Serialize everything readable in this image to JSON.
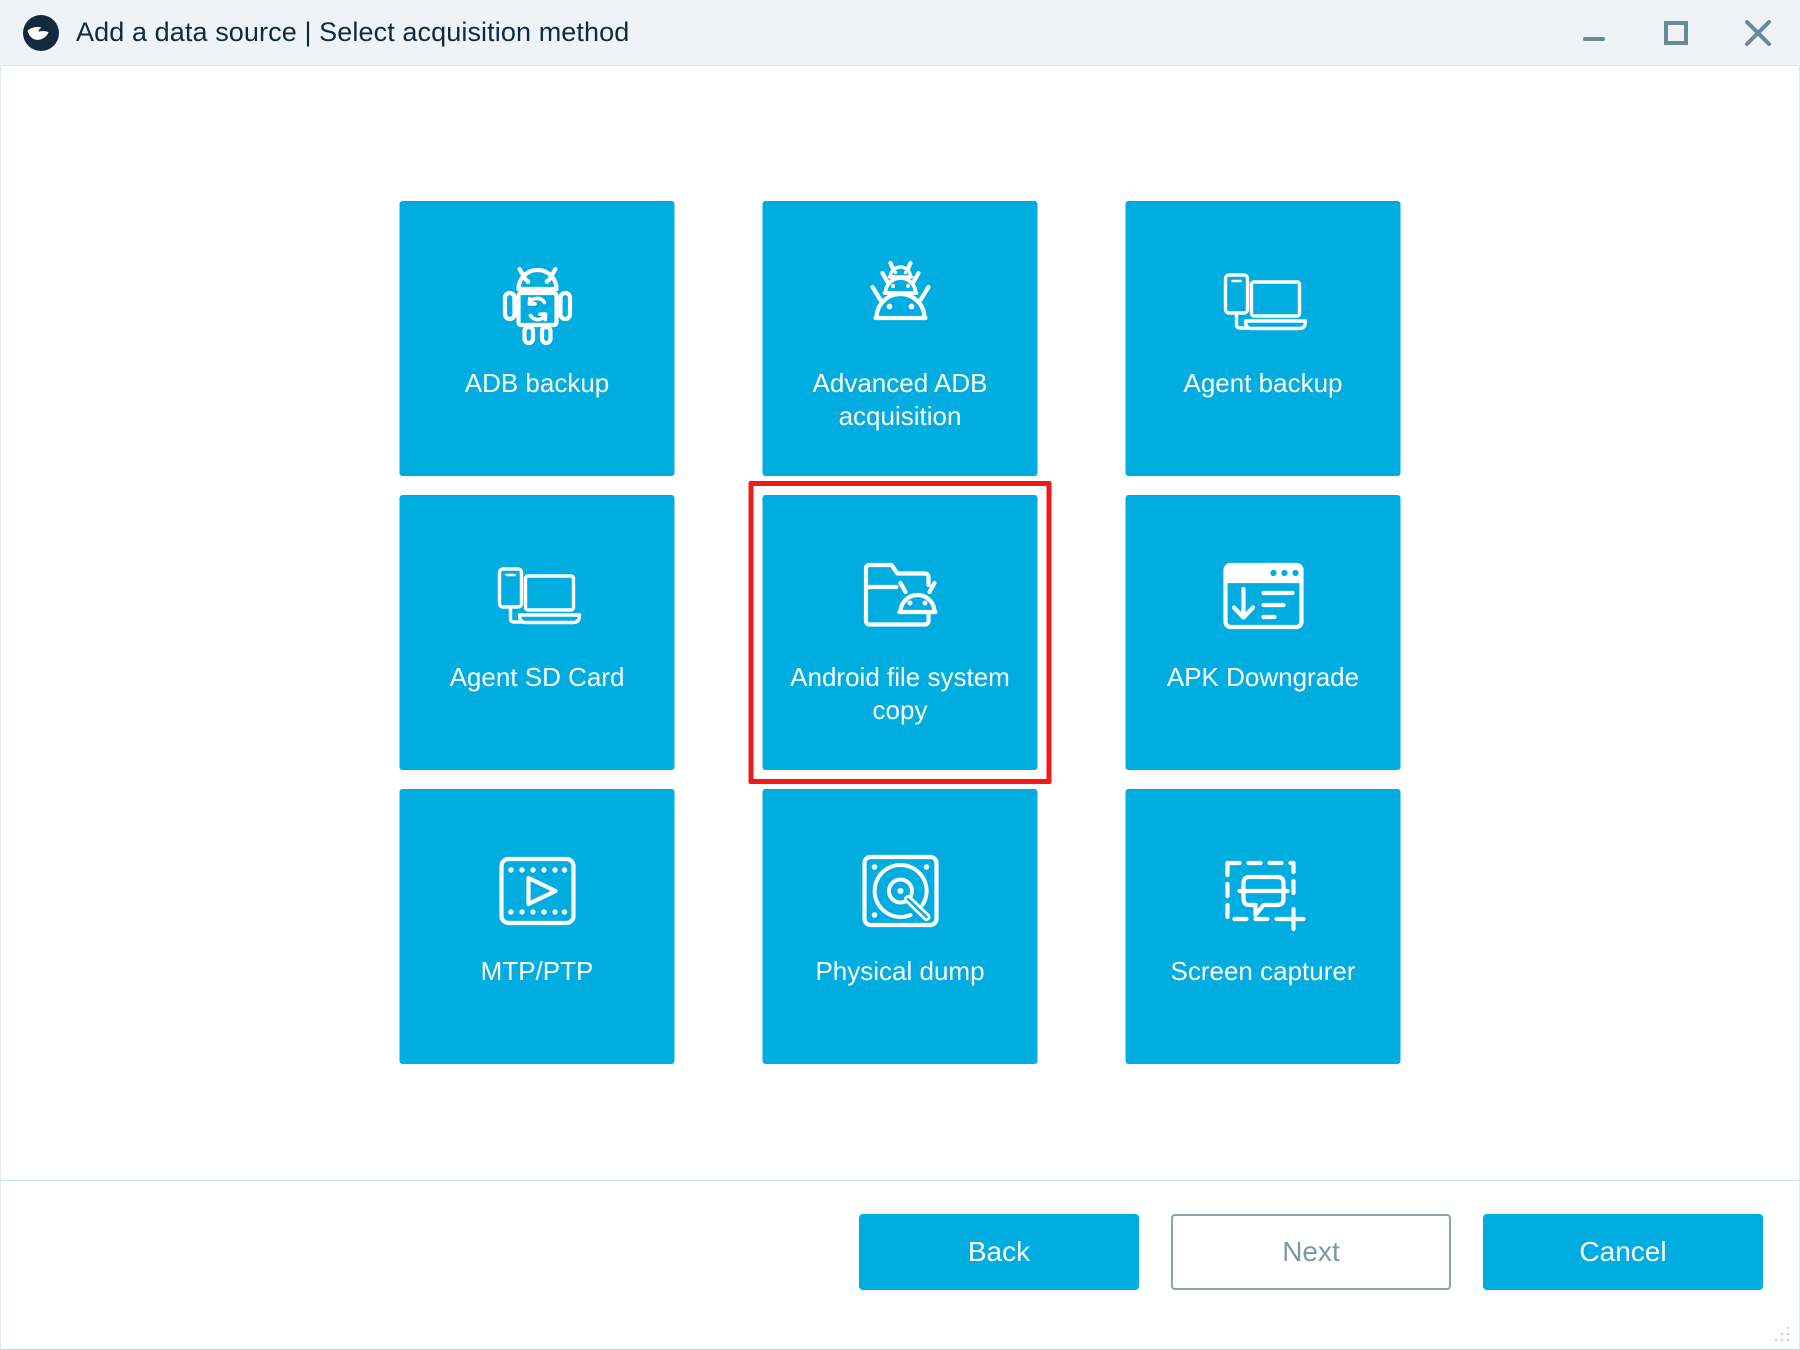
{
  "window": {
    "title": "Add a data source | Select acquisition method",
    "logo_icon": "swift-bird-logo",
    "controls": [
      {
        "name": "minimize",
        "icon": "minimize-icon"
      },
      {
        "name": "maximize",
        "icon": "maximize-icon"
      },
      {
        "name": "close",
        "icon": "close-icon"
      }
    ]
  },
  "colors": {
    "tile": "#00ade1",
    "tile_text": "#ffffff",
    "titlebar_bg": "#eef3f7",
    "title_text": "#13293d",
    "selection_outline": "#ef1b1b",
    "primary_button": "#00ade1",
    "disabled_button_text": "#7d98a6",
    "window_control": "#6b8896"
  },
  "tiles": [
    {
      "label": "ADB backup",
      "icon": "android-robot-sync-icon",
      "selected": false
    },
    {
      "label": "Advanced ADB acquisition",
      "icon": "android-heads-stack-icon",
      "selected": false
    },
    {
      "label": "Agent backup",
      "icon": "phone-laptop-icon",
      "selected": false
    },
    {
      "label": "Agent SD Card",
      "icon": "phone-laptop-icon",
      "selected": false
    },
    {
      "label": "Android file system copy",
      "icon": "folder-android-icon",
      "selected": true
    },
    {
      "label": "APK Downgrade",
      "icon": "window-download-list-icon",
      "selected": false
    },
    {
      "label": "MTP/PTP",
      "icon": "film-strip-play-icon",
      "selected": false
    },
    {
      "label": "Physical dump",
      "icon": "hard-disk-icon",
      "selected": false
    },
    {
      "label": "Screen capturer",
      "icon": "screen-capture-icon",
      "selected": false
    }
  ],
  "footer": {
    "back_label": "Back",
    "next_label": "Next",
    "cancel_label": "Cancel",
    "next_enabled": false
  }
}
